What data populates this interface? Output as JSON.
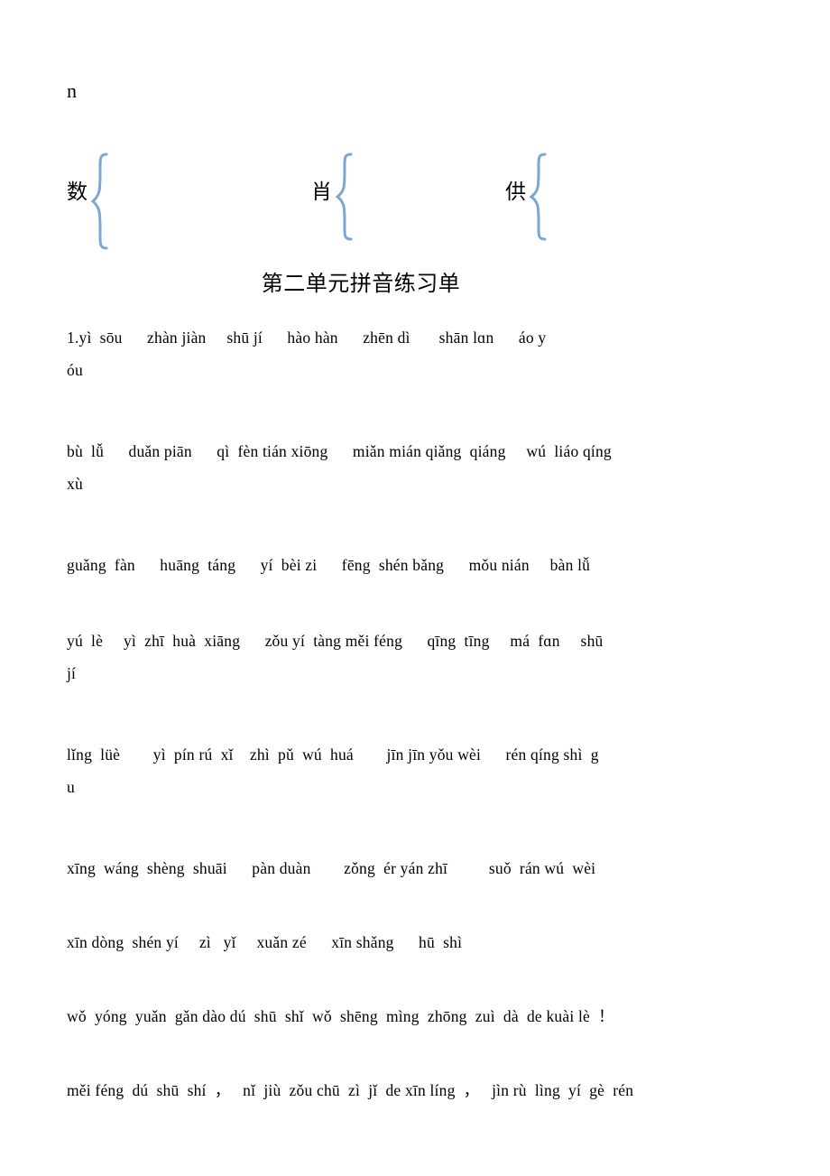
{
  "document": {
    "stray_letter": "n",
    "title": "第二单元拼音练习单",
    "brace_groups": [
      {
        "character": "数",
        "brace": "curly-brace-right"
      },
      {
        "character": "肖",
        "brace": "curly-brace-right"
      },
      {
        "character": "供",
        "brace": "curly-brace-right"
      }
    ],
    "brace_color": "#7BA7D0",
    "lines": [
      "1.yì  sōu      zhàn jiàn     shū jí      hào hàn      zhēn dì       shān lɑn      áo y\nóu",
      "bù  lǚ      duǎn piān      qì  fèn tián xiōng      miǎn mián qiǎng  qiáng     wú  liáo qíng\nxù",
      "guǎng  fàn      huāng  táng      yí  bèi zi      fēng  shén bǎng      mǒu nián     bàn lǚ",
      "yú  lè     yì  zhī  huà  xiāng      zǒu yí  tàng měi féng      qīng  tīng     má  fɑn     shū\njí",
      "lǐng  lüè        yì  pín rú  xǐ    zhì  pǔ  wú  huá        jīn jīn yǒu wèi      rén qíng shì  g\nu",
      "xīng  wáng  shèng  shuāi      pàn duàn        zǒng  ér yán zhī          suǒ  rán wú  wèi",
      "xīn dòng  shén yí     zì   yǐ     xuǎn zé      xīn shǎng      hū  shì",
      "wǒ  yóng  yuǎn  gǎn dào dú  shū  shǐ  wǒ  shēng  mìng  zhōng  zuì  dà  de kuài lè  ！",
      "měi féng  dú  shū  shí  ，   nǐ  jiù  zǒu chū  zì  jǐ  de xīn líng  ，   jìn rù  lìng  yí  gè  rén"
    ]
  }
}
